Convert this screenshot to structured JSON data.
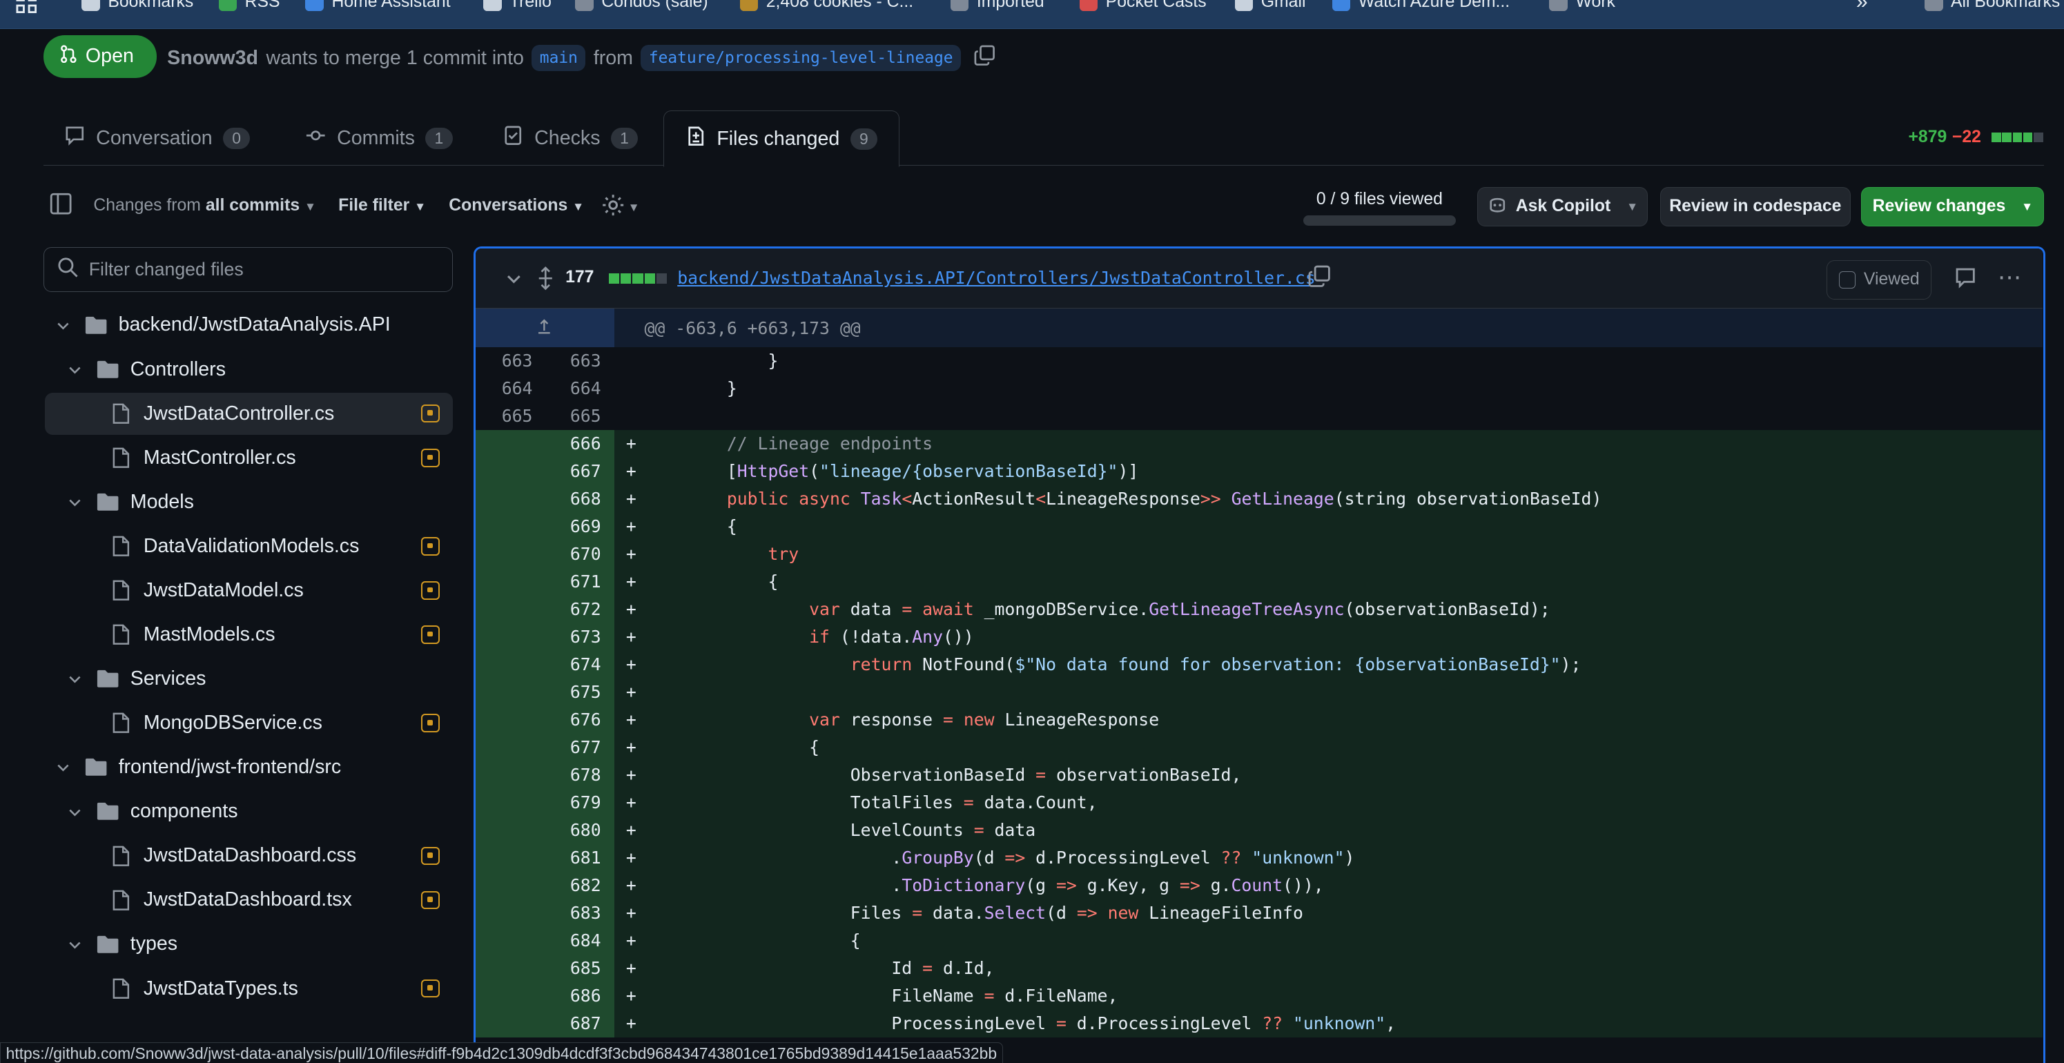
{
  "bookmarks": [
    {
      "label": "Bookmarks",
      "icon": "star-icon",
      "color": "#e6edf3"
    },
    {
      "label": "RSS",
      "icon": "rss-icon",
      "color": "#3fb950"
    },
    {
      "label": "Home Assistant",
      "icon": "home-icon",
      "color": "#4493f8"
    },
    {
      "label": "Trello",
      "icon": "trello-icon",
      "color": "#e6edf3"
    },
    {
      "label": "Condos (sale)",
      "icon": "building-icon",
      "color": "#9198a1"
    },
    {
      "label": "2,408 cookies - C...",
      "icon": "cookie-icon",
      "color": "#d29922"
    },
    {
      "label": "Imported",
      "icon": "folder-icon",
      "color": "#9198a1"
    },
    {
      "label": "Pocket Casts",
      "icon": "podcast-icon",
      "color": "#f85149"
    },
    {
      "label": "Gmail",
      "icon": "gmail-icon",
      "color": "#e6edf3"
    },
    {
      "label": "Watch Azure Dem...",
      "icon": "windows-icon",
      "color": "#4493f8"
    },
    {
      "label": "Work",
      "icon": "folder-icon",
      "color": "#9198a1"
    },
    {
      "label": "All Bookmarks",
      "icon": "folder-icon",
      "color": "#9198a1"
    }
  ],
  "pr": {
    "state": "Open",
    "author": "Snoww3d",
    "merge_text": "wants to merge 1 commit into",
    "base": "main",
    "from_text": "from",
    "head": "feature/processing-level-lineage"
  },
  "tabs": [
    {
      "label": "Conversation",
      "count": "0"
    },
    {
      "label": "Commits",
      "count": "1"
    },
    {
      "label": "Checks",
      "count": "1"
    },
    {
      "label": "Files changed",
      "count": "9"
    }
  ],
  "diffstat": {
    "additions": "+879",
    "deletions": "−22",
    "colors": {
      "add": "#3fb950",
      "del": "#f85149"
    }
  },
  "toolbar": {
    "changes_from": "Changes from",
    "all_commits": "all commits",
    "file_filter": "File filter",
    "conversations": "Conversations",
    "files_viewed": "0 / 9 files viewed",
    "ask_copilot": "Ask Copilot",
    "review_codespace": "Review in codespace",
    "review_changes": "Review changes"
  },
  "filter": {
    "placeholder": "Filter changed files"
  },
  "tree": [
    {
      "type": "folder",
      "label": "backend/JwstDataAnalysis.API",
      "depth": 0
    },
    {
      "type": "folder",
      "label": "Controllers",
      "depth": 1
    },
    {
      "type": "file",
      "label": "JwstDataController.cs",
      "depth": 2,
      "selected": true
    },
    {
      "type": "file",
      "label": "MastController.cs",
      "depth": 2
    },
    {
      "type": "folder",
      "label": "Models",
      "depth": 1
    },
    {
      "type": "file",
      "label": "DataValidationModels.cs",
      "depth": 2
    },
    {
      "type": "file",
      "label": "JwstDataModel.cs",
      "depth": 2
    },
    {
      "type": "file",
      "label": "MastModels.cs",
      "depth": 2
    },
    {
      "type": "folder",
      "label": "Services",
      "depth": 1
    },
    {
      "type": "file",
      "label": "MongoDBService.cs",
      "depth": 2
    },
    {
      "type": "folder",
      "label": "frontend/jwst-frontend/src",
      "depth": 0
    },
    {
      "type": "folder",
      "label": "components",
      "depth": 1
    },
    {
      "type": "file",
      "label": "JwstDataDashboard.css",
      "depth": 2
    },
    {
      "type": "file",
      "label": "JwstDataDashboard.tsx",
      "depth": 2
    },
    {
      "type": "folder",
      "label": "types",
      "depth": 1
    },
    {
      "type": "file",
      "label": "JwstDataTypes.ts",
      "depth": 2
    }
  ],
  "diff": {
    "count": "177",
    "filename": "backend/JwstDataAnalysis.API/Controllers/JwstDataController.cs",
    "viewed": "Viewed",
    "hunk": "@@ -663,6 +663,173 @@",
    "lines": [
      {
        "o": "663",
        "n": "663",
        "t": "ctx",
        "c": "            }"
      },
      {
        "o": "664",
        "n": "664",
        "t": "ctx",
        "c": "        }"
      },
      {
        "o": "665",
        "n": "665",
        "t": "ctx",
        "c": ""
      },
      {
        "o": "",
        "n": "666",
        "t": "add",
        "c": "        // Lineage endpoints"
      },
      {
        "o": "",
        "n": "667",
        "t": "add",
        "c": "        [HttpGet(\"lineage/{observationBaseId}\")]"
      },
      {
        "o": "",
        "n": "668",
        "t": "add",
        "c": "        public async Task<ActionResult<LineageResponse>> GetLineage(string observationBaseId)"
      },
      {
        "o": "",
        "n": "669",
        "t": "add",
        "c": "        {"
      },
      {
        "o": "",
        "n": "670",
        "t": "add",
        "c": "            try"
      },
      {
        "o": "",
        "n": "671",
        "t": "add",
        "c": "            {"
      },
      {
        "o": "",
        "n": "672",
        "t": "add",
        "c": "                var data = await _mongoDBService.GetLineageTreeAsync(observationBaseId);"
      },
      {
        "o": "",
        "n": "673",
        "t": "add",
        "c": "                if (!data.Any())"
      },
      {
        "o": "",
        "n": "674",
        "t": "add",
        "c": "                    return NotFound($\"No data found for observation: {observationBaseId}\");"
      },
      {
        "o": "",
        "n": "675",
        "t": "add",
        "c": ""
      },
      {
        "o": "",
        "n": "676",
        "t": "add",
        "c": "                var response = new LineageResponse"
      },
      {
        "o": "",
        "n": "677",
        "t": "add",
        "c": "                {"
      },
      {
        "o": "",
        "n": "678",
        "t": "add",
        "c": "                    ObservationBaseId = observationBaseId,"
      },
      {
        "o": "",
        "n": "679",
        "t": "add",
        "c": "                    TotalFiles = data.Count,"
      },
      {
        "o": "",
        "n": "680",
        "t": "add",
        "c": "                    LevelCounts = data"
      },
      {
        "o": "",
        "n": "681",
        "t": "add",
        "c": "                        .GroupBy(d => d.ProcessingLevel ?? \"unknown\")"
      },
      {
        "o": "",
        "n": "682",
        "t": "add",
        "c": "                        .ToDictionary(g => g.Key, g => g.Count()),"
      },
      {
        "o": "",
        "n": "683",
        "t": "add",
        "c": "                    Files = data.Select(d => new LineageFileInfo"
      },
      {
        "o": "",
        "n": "684",
        "t": "add",
        "c": "                    {"
      },
      {
        "o": "",
        "n": "685",
        "t": "add",
        "c": "                        Id = d.Id,"
      },
      {
        "o": "",
        "n": "686",
        "t": "add",
        "c": "                        FileName = d.FileName,"
      },
      {
        "o": "",
        "n": "687",
        "t": "add",
        "c": "                        ProcessingLevel = d.ProcessingLevel ?? \"unknown\","
      }
    ]
  },
  "status_url": "https://github.com/Snoww3d/jwst-data-analysis/pull/10/files#diff-f9b4d2c1309db4dcdf3f3cbd968434743801ce1765bd9389d14415e1aaa532bb"
}
